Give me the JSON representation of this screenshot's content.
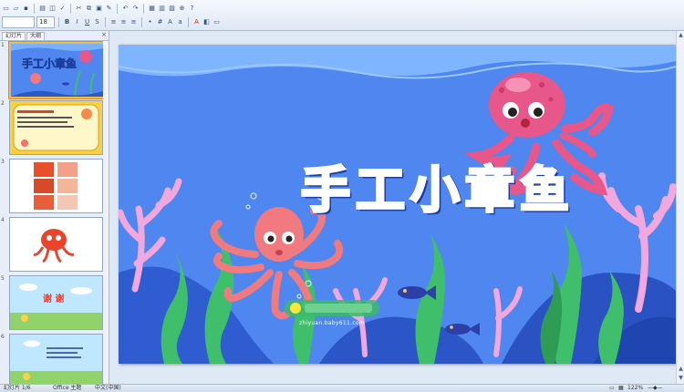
{
  "toolbar": {
    "font_size": "18",
    "icons_row1": [
      "new-icon",
      "open-icon",
      "save-icon",
      "print-icon",
      "preview-icon",
      "spell-icon",
      "cut-icon",
      "copy-icon",
      "paste-icon",
      "format-painter-icon",
      "undo-icon",
      "redo-icon",
      "table-icon",
      "chart-icon",
      "picture-icon",
      "zoom-icon",
      "help-icon"
    ],
    "icons_row2": [
      "bold-icon",
      "italic-icon",
      "underline-icon",
      "shadow-icon",
      "align-left-icon",
      "center-icon",
      "align-right-icon",
      "bullets-icon",
      "numbering-icon",
      "increase-font-icon",
      "decrease-font-icon",
      "font-color-icon",
      "design-icon",
      "new-slide-icon"
    ]
  },
  "slide_pane": {
    "tabs": [
      "幻灯片",
      "大纲"
    ],
    "close_glyph": "×",
    "slides": [
      {
        "number": "1",
        "title": "手工小章鱼"
      },
      {
        "number": "2",
        "title": ""
      },
      {
        "number": "3",
        "title": ""
      },
      {
        "number": "4",
        "title": ""
      },
      {
        "number": "5",
        "title": "谢 谢"
      },
      {
        "number": "6",
        "title": ""
      }
    ],
    "selected_index": 0
  },
  "slide": {
    "title": "手工小章鱼",
    "watermark_site": "zhiyuan.baby611.com",
    "colors": {
      "background": "#4f86f0",
      "title_fill": "#ffe63a",
      "octopus": "#f07a80",
      "octopus_pink": "#e8578a",
      "seaweed": "#3fbf6b",
      "coral_pink": "#f3a7df",
      "fish": "#2d3fa8"
    }
  },
  "statusbar": {
    "slide_info": "幻灯片 1/6",
    "theme": "Office 主题",
    "language": "中文(中国)",
    "zoom": "122%"
  }
}
